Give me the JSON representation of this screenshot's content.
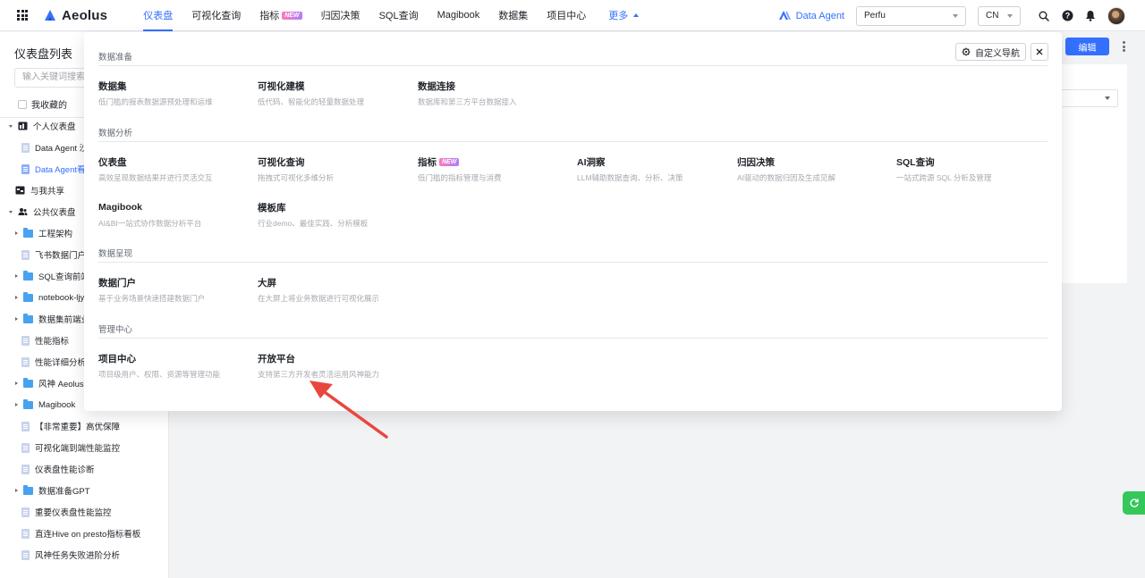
{
  "topbar": {
    "logo_text": "Aeolus",
    "nav": [
      {
        "label": "仪表盘",
        "active": true
      },
      {
        "label": "可视化查询"
      },
      {
        "label": "指标",
        "badge": "NEW"
      },
      {
        "label": "归因决策"
      },
      {
        "label": "SQL查询"
      },
      {
        "label": "Magibook"
      },
      {
        "label": "数据集"
      },
      {
        "label": "项目中心"
      }
    ],
    "more_label": "更多",
    "agent_label": "Data Agent",
    "project_select": "Perfu",
    "lang_select": "CN"
  },
  "sidebar": {
    "title": "仪表盘列表",
    "search_placeholder": "输入关键词搜索",
    "favorites_label": "我收藏的",
    "items": [
      {
        "label": "个人仪表盘"
      },
      {
        "label": "Data Agent 沙箱"
      },
      {
        "label": "Data Agent看板"
      },
      {
        "label": "与我共享"
      },
      {
        "label": "公共仪表盘"
      },
      {
        "label": "工程架构"
      },
      {
        "label": "飞书数据门户 仪"
      },
      {
        "label": "SQL查询前端业"
      },
      {
        "label": "notebook-ljy"
      },
      {
        "label": "数据集前端业务"
      },
      {
        "label": "性能指标"
      },
      {
        "label": "性能详细分析"
      },
      {
        "label": "风神 Aeolus"
      },
      {
        "label": "Magibook"
      },
      {
        "label": "【非常重要】高优保障"
      },
      {
        "label": "可视化端到端性能监控"
      },
      {
        "label": "仪表盘性能诊断"
      },
      {
        "label": "数据准备GPT"
      },
      {
        "label": "重要仪表盘性能监控"
      },
      {
        "label": "直连Hive on presto指标看板"
      },
      {
        "label": "风神任务失败进阶分析"
      }
    ]
  },
  "main": {
    "edit_label": "编辑"
  },
  "panel": {
    "custom_nav_label": "自定义导航",
    "sections": [
      {
        "title": "数据准备",
        "cards": [
          {
            "title": "数据集",
            "desc": "低门槛的报表数据源预处理和运维"
          },
          {
            "title": "可视化建模",
            "desc": "低代码、智能化的轻量数据处理"
          },
          {
            "title": "数据连接",
            "desc": "数据库和第三方平台数据接入"
          }
        ]
      },
      {
        "title": "数据分析",
        "cards": [
          {
            "title": "仪表盘",
            "desc": "高效呈现数据结果并进行灵活交互"
          },
          {
            "title": "可视化查询",
            "desc": "拖拽式可视化多维分析"
          },
          {
            "title": "指标",
            "desc": "低门槛的指标管理与消费",
            "badge": "NEW"
          },
          {
            "title": "AI洞察",
            "desc": "LLM辅助数据查询、分析、决策"
          },
          {
            "title": "归因决策",
            "desc": "AI驱动的数据归因及生成见解"
          },
          {
            "title": "SQL查询",
            "desc": "一站式跨源 SQL 分析及管理"
          },
          {
            "title": "Magibook",
            "desc": "AI&BI一站式协作数据分析平台"
          },
          {
            "title": "模板库",
            "desc": "行业demo、最佳实践、分析模板"
          }
        ]
      },
      {
        "title": "数据呈现",
        "cards": [
          {
            "title": "数据门户",
            "desc": "基于业务场景快速搭建数据门户"
          },
          {
            "title": "大屏",
            "desc": "在大屏上将业务数据进行可视化展示"
          }
        ]
      },
      {
        "title": "管理中心",
        "cards": [
          {
            "title": "项目中心",
            "desc": "项目级用户、权限、资源等管理功能"
          },
          {
            "title": "开放平台",
            "desc": "支持第三方开发者灵活运用风神能力"
          }
        ]
      }
    ]
  },
  "colors": {
    "accent": "#3370ff",
    "annotation_arrow": "#e8473e"
  }
}
